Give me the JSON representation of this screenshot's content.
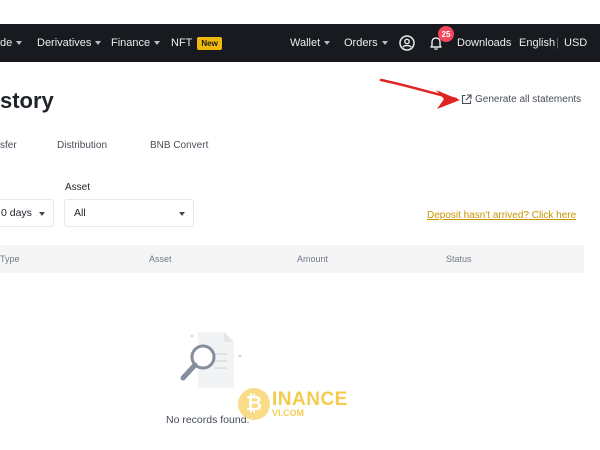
{
  "nav": {
    "trade_label": "de",
    "derivatives_label": "Derivatives",
    "finance_label": "Finance",
    "nft_label": "NFT",
    "nft_badge": "New",
    "wallet_label": "Wallet",
    "orders_label": "Orders",
    "notification_count": "25",
    "downloads_label": "Downloads",
    "language_label": "English",
    "currency_label": "USD"
  },
  "page": {
    "title": "story",
    "generate_label": "Generate all statements"
  },
  "tabs": [
    {
      "label": "sfer"
    },
    {
      "label": "Distribution"
    },
    {
      "label": "BNB Convert"
    }
  ],
  "filters": {
    "time_value": "0 days",
    "asset_label": "Asset",
    "asset_value": "All"
  },
  "deposit_link": "Deposit hasn't arrived? Click here",
  "table": {
    "columns": [
      "Type",
      "Asset",
      "Amount",
      "Status"
    ]
  },
  "empty_state": "No records found.",
  "watermark": {
    "title": "INANCE",
    "subtitle": "VI.COM"
  },
  "colors": {
    "topbar": "#181a20",
    "accent": "#f0b90b",
    "link": "#c99400",
    "annotation_arrow": "#e02424"
  }
}
